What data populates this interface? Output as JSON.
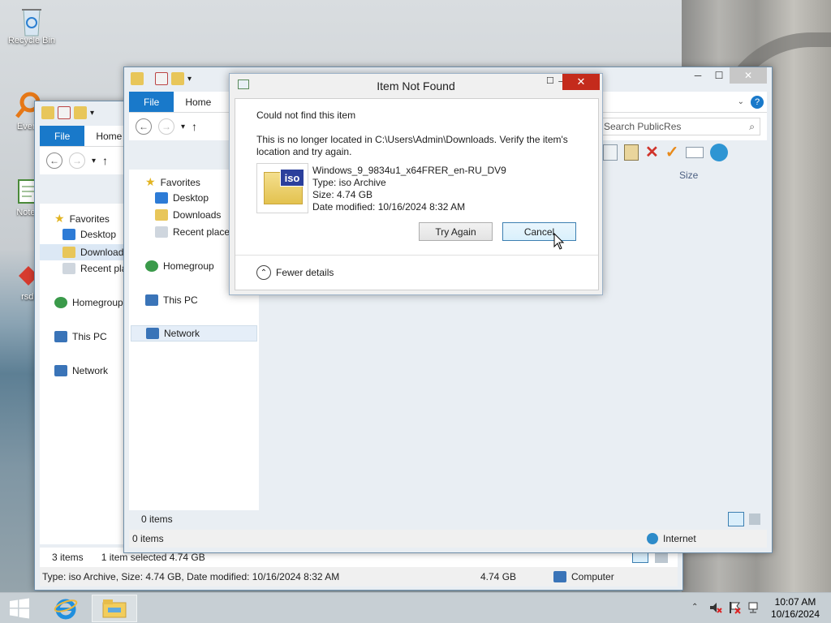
{
  "desktop": {
    "icons": [
      {
        "label": "Recycle Bin",
        "icon": "recycle-bin-icon"
      },
      {
        "label": "Every",
        "icon": "everything-search-icon"
      },
      {
        "label": "Notep",
        "icon": "notepad-icon"
      },
      {
        "label": "rsdi",
        "icon": "shortcut-icon"
      }
    ]
  },
  "back_explorer": {
    "tabs": {
      "file": "File",
      "home": "Home"
    },
    "tree": {
      "favorites": "Favorites",
      "desktop": "Desktop",
      "downloads": "Downloads",
      "recent": "Recent places",
      "homegroup": "Homegroup",
      "this_pc": "This PC",
      "network": "Network"
    },
    "status": {
      "items": "3 items",
      "selected": "1 item selected  4.74 GB",
      "details": "Type: iso Archive, Size: 4.74 GB, Date modified: 10/16/2024 8:32 AM",
      "size": "4.74 GB",
      "location": "Computer"
    }
  },
  "front_explorer": {
    "tabs": {
      "file": "File",
      "home": "Home"
    },
    "search_placeholder": "Search PublicRes",
    "column_size": "Size",
    "tree": {
      "favorites": "Favorites",
      "desktop": "Desktop",
      "downloads": "Downloads",
      "recent": "Recent places",
      "homegroup": "Homegroup",
      "this_pc": "This PC",
      "network": "Network"
    },
    "content_items": "0 items",
    "status": {
      "items": "0 items",
      "zone": "Internet"
    }
  },
  "dialog": {
    "title": "Item Not Found",
    "heading": "Could not find this item",
    "message": "This is no longer located in C:\\Users\\Admin\\Downloads. Verify the item's location and try again.",
    "file": {
      "icon_text": "iso",
      "name": "Windows_9_9834u1_x64FRER_en-RU_DV9",
      "type": "Type: iso Archive",
      "size": "Size: 4.74 GB",
      "modified": "Date modified: 10/16/2024 8:32 AM"
    },
    "try_again": "Try Again",
    "cancel": "Cancel",
    "fewer_details": "Fewer details"
  },
  "taskbar": {
    "time": "10:07 AM",
    "date": "10/16/2024"
  },
  "colors": {
    "accent": "#1979ca",
    "close_button": "#c7c7c7",
    "dialog_close": "#c42b1c"
  }
}
